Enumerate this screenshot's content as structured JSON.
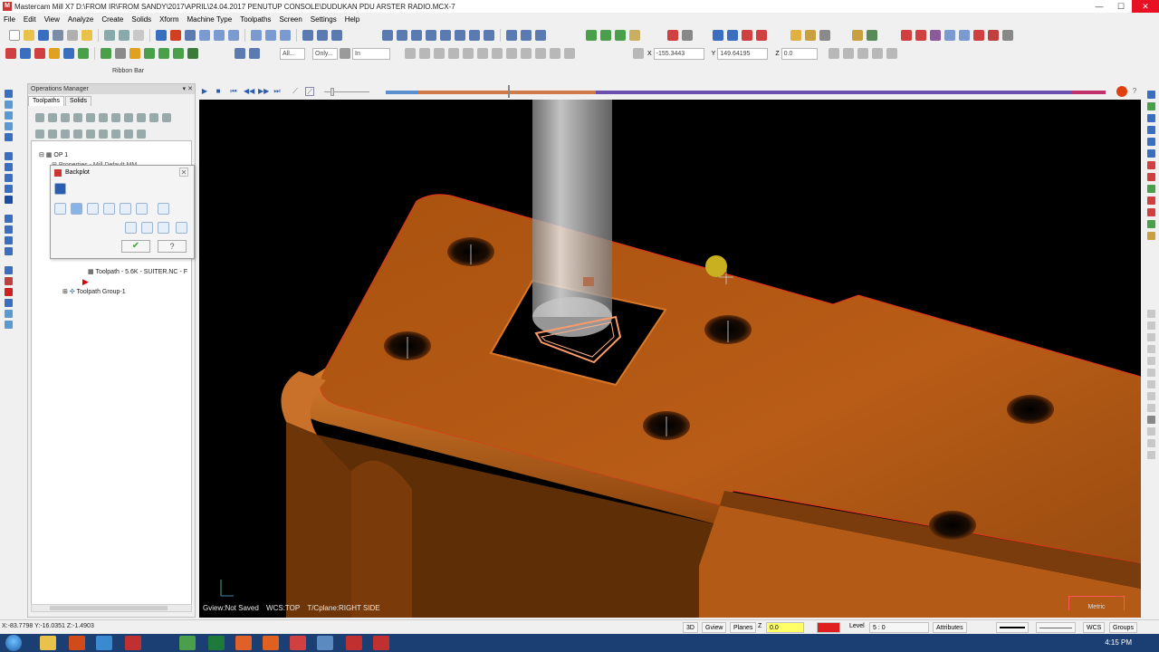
{
  "window": {
    "title": "Mastercam Mill X7  D:\\FROM IR\\FROM SANDY\\2017\\APRIL\\24.04.2017 PENUTUP CONSOLE\\DUDUKAN PDU ARSTER RADIO.MCX-7",
    "minimize": "—",
    "maximize": "☐",
    "close": "✕"
  },
  "menu": [
    "File",
    "Edit",
    "View",
    "Analyze",
    "Create",
    "Solids",
    "Xform",
    "Machine Type",
    "Toolpaths",
    "Screen",
    "Settings",
    "Help"
  ],
  "toolbar2": {
    "all_field": "All...",
    "only_field": "Only...",
    "in_field": "In",
    "x_label": "X",
    "x_value": "-155.3443",
    "y_label": "Y",
    "y_value": "149.64195",
    "z_label": "Z",
    "z_value": "0.0"
  },
  "ribbon_bar_label": "Ribbon Bar",
  "ops_manager": {
    "title": "Operations Manager",
    "tabs": [
      "Toolpaths",
      "Solids"
    ],
    "tree": {
      "op": "OP 1",
      "properties": "Properties - Mill Default MM",
      "toolpath": "Toolpath - 5.6K - SUITER.NC - F",
      "group": "Toolpath Group-1"
    }
  },
  "backplot": {
    "title": "Backplot",
    "ok_glyph": "✔",
    "help_glyph": "?"
  },
  "playbar": {
    "progress_fraction": 0.17
  },
  "viewport": {
    "gview": "Gview:Not Saved",
    "wcs": "WCS:TOP",
    "tplane": "T/Cplane:RIGHT SIDE",
    "units": "Metric"
  },
  "status": {
    "coords": "X:-83.7798   Y:-16.0351   Z:-1.4903",
    "btn_3d": "3D",
    "gview": "Gview",
    "planes": "Planes",
    "z_label": "Z",
    "z_value": "0.0",
    "level_label": "Level",
    "level_value": "5 : 0",
    "attributes": "Attributes",
    "wcs": "WCS",
    "groups": "Groups"
  },
  "taskbar": {
    "clock": "4:15 PM"
  },
  "colors": {
    "part": "#b55a15",
    "part_highlight": "#d9782a",
    "edge": "#e8321c",
    "viewport_bg": "#000000",
    "progress_base": "#6a4fb0"
  }
}
